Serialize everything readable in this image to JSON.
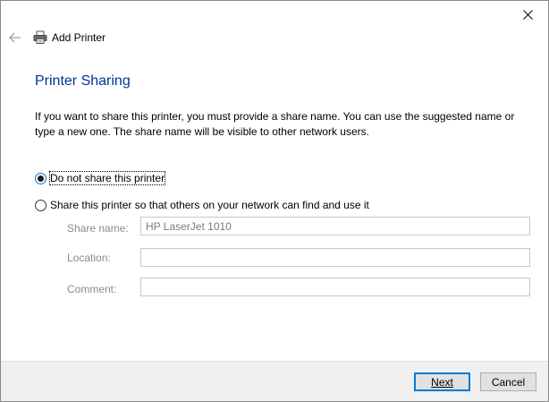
{
  "window": {
    "title": "Add Printer"
  },
  "page": {
    "heading": "Printer Sharing"
  },
  "description": "If you want to share this printer, you must provide a share name. You can use the suggested name or type a new one. The share name will be visible to other network users.",
  "options": {
    "no_share": {
      "label": "Do not share this printer",
      "selected": true
    },
    "share": {
      "label": "Share this printer so that others on your network can find and use it",
      "selected": false
    }
  },
  "fields": {
    "share_name": {
      "label": "Share name:",
      "value": "HP LaserJet 1010"
    },
    "location": {
      "label": "Location:",
      "value": ""
    },
    "comment": {
      "label": "Comment:",
      "value": ""
    }
  },
  "buttons": {
    "next": "Next",
    "cancel": "Cancel"
  },
  "icons": {
    "back": "back-arrow-icon",
    "printer": "printer-icon",
    "close": "close-icon"
  },
  "colors": {
    "heading": "#003399",
    "accent": "#0078d7",
    "footer_bg": "#f0f0f0"
  }
}
